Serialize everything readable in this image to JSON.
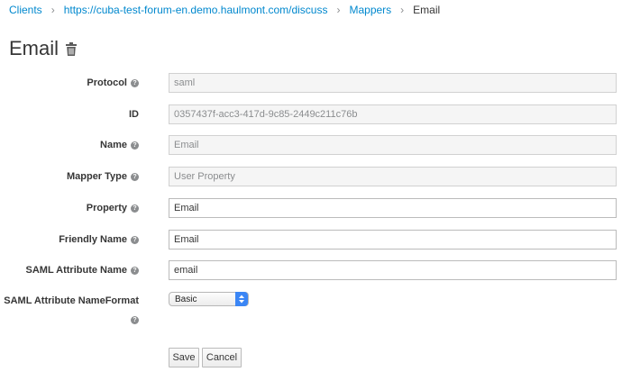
{
  "breadcrumb": {
    "items": [
      "Clients",
      "https://cuba-test-forum-en.demo.haulmont.com/discuss",
      "Mappers"
    ],
    "current": "Email",
    "separator": "›"
  },
  "page": {
    "title": "Email"
  },
  "form": {
    "protocol": {
      "label": "Protocol",
      "value": "saml"
    },
    "id": {
      "label": "ID",
      "value": "0357437f-acc3-417d-9c85-2449c211c76b"
    },
    "name": {
      "label": "Name",
      "value": "Email"
    },
    "mapper_type": {
      "label": "Mapper Type",
      "value": "User Property"
    },
    "property": {
      "label": "Property",
      "value": "Email"
    },
    "friendly_name": {
      "label": "Friendly Name",
      "value": "Email"
    },
    "saml_attribute_name": {
      "label": "SAML Attribute Name",
      "value": "email"
    },
    "saml_attribute_nameformat": {
      "label": "SAML Attribute NameFormat",
      "value": "Basic"
    }
  },
  "help_glyph": "?",
  "buttons": {
    "save": "Save",
    "cancel": "Cancel"
  },
  "colors": {
    "link": "#0088ce",
    "readonly_bg": "#f5f5f5",
    "select_arrow": "#3b86f5"
  }
}
